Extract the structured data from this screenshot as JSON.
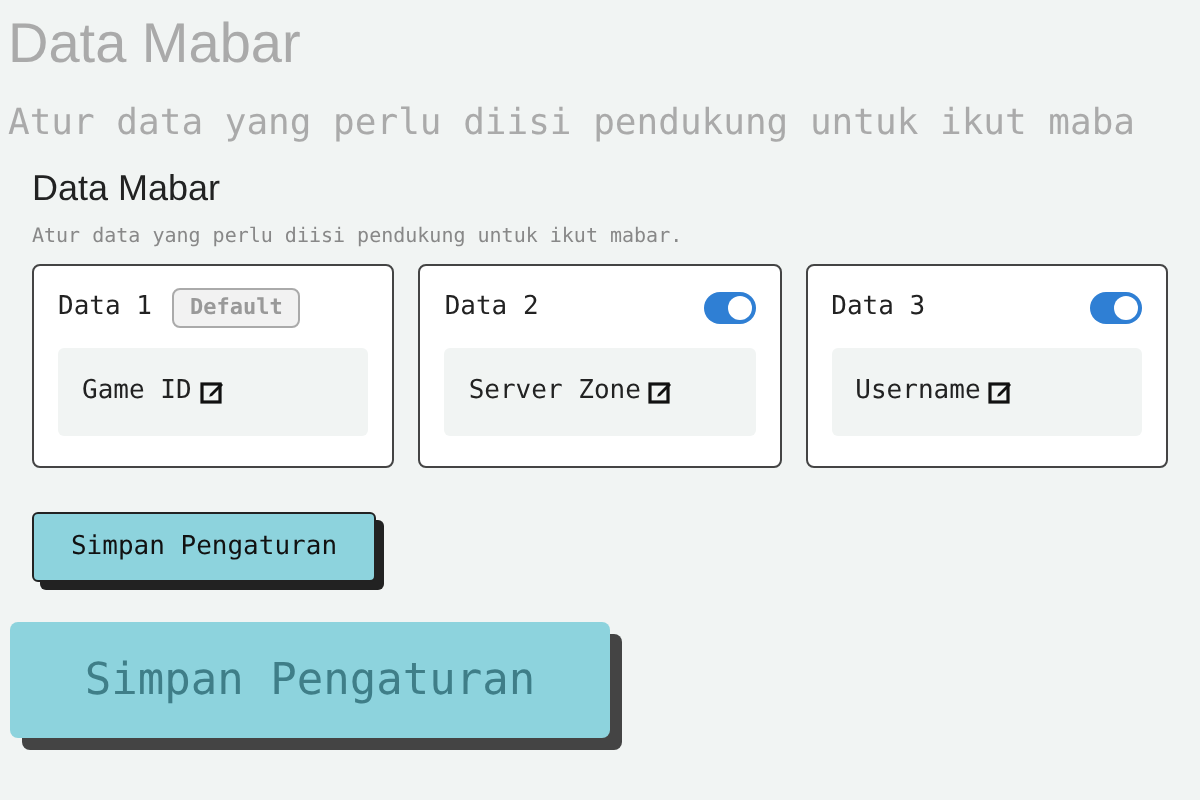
{
  "backdrop": {
    "title": "Data Mabar",
    "subtitle": "Atur data yang perlu diisi pendukung untuk ikut maba",
    "button": "Simpan Pengaturan"
  },
  "title": "Data Mabar",
  "subtitle": "Atur data yang perlu diisi pendukung untuk ikut mabar.",
  "cards": [
    {
      "label": "Data 1",
      "kind": "badge",
      "badge": "Default",
      "field": "Game ID"
    },
    {
      "label": "Data 2",
      "kind": "switch",
      "on": true,
      "field": "Server Zone"
    },
    {
      "label": "Data 3",
      "kind": "switch",
      "on": true,
      "field": "Username"
    }
  ],
  "save_button": "Simpan Pengaturan"
}
